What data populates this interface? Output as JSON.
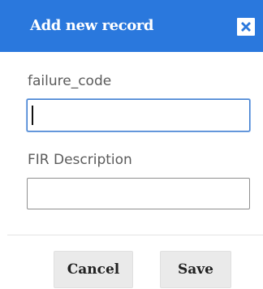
{
  "dialog": {
    "title": "Add new record",
    "close_icon": "close-x-icon",
    "accent_color": "#2a78dd"
  },
  "form": {
    "fields": [
      {
        "label": "failure_code",
        "value": "",
        "focused": true
      },
      {
        "label": "FIR Description",
        "value": "",
        "focused": false
      }
    ]
  },
  "buttons": {
    "cancel_label": "Cancel",
    "save_label": "Save"
  }
}
